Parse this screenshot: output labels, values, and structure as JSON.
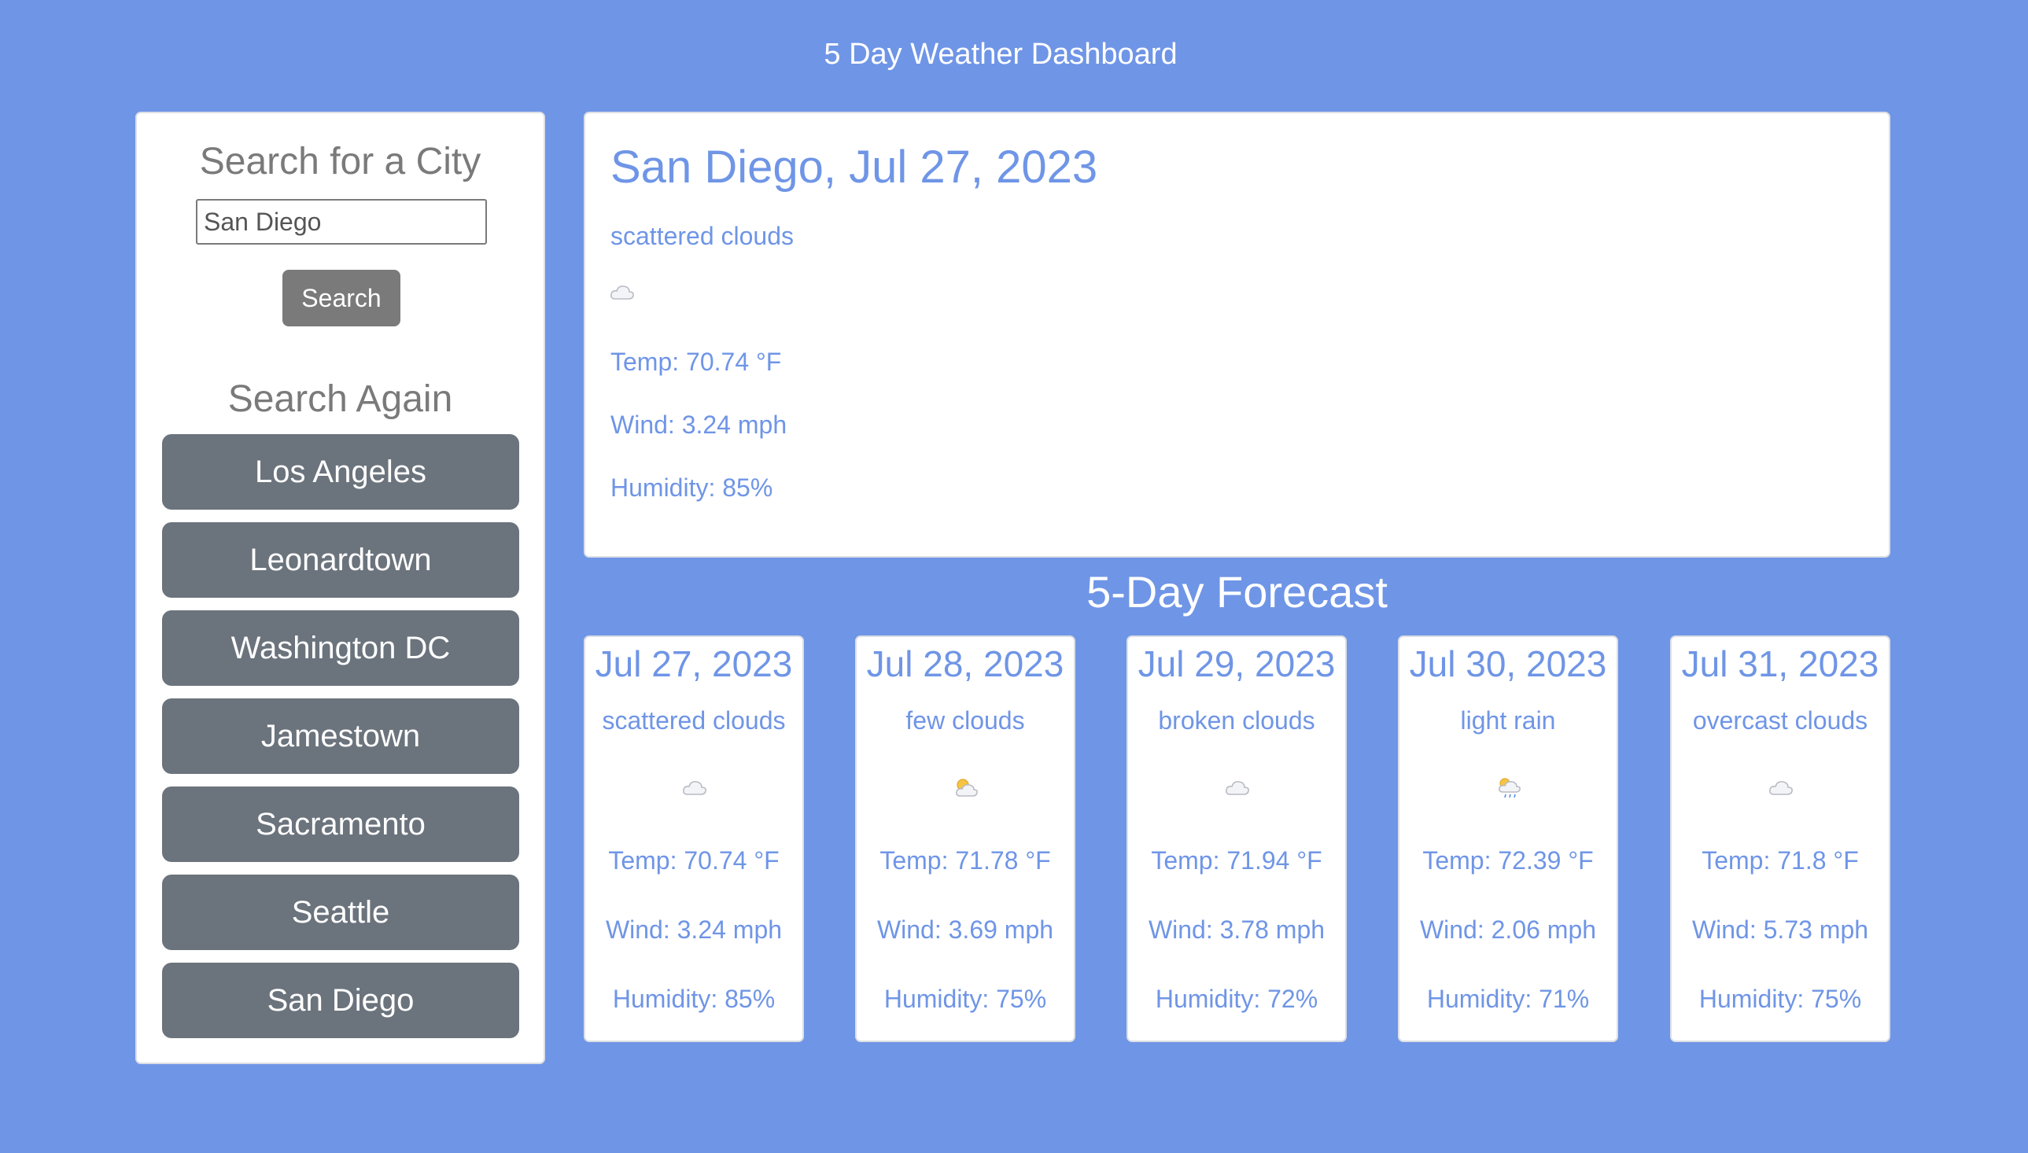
{
  "header": {
    "title": "5 Day Weather Dashboard"
  },
  "sidebar": {
    "search_heading": "Search for a City",
    "search_value": "San Diego",
    "search_button": "Search",
    "again_heading": "Search Again",
    "cities": [
      "Los Angeles",
      "Leonardtown",
      "Washington DC",
      "Jamestown",
      "Sacramento",
      "Seattle",
      "San Diego"
    ]
  },
  "current": {
    "title": "San Diego, Jul 27, 2023",
    "description": "scattered clouds",
    "icon": "scattered-clouds-icon",
    "temp": "Temp: 70.74 °F",
    "wind": "Wind: 3.24 mph",
    "humidity": "Humidity: 85%"
  },
  "forecast_heading": "5-Day Forecast",
  "forecast": [
    {
      "date": "Jul 27, 2023",
      "description": "scattered clouds",
      "icon": "scattered-clouds-icon",
      "temp": "Temp: 70.74 °F",
      "wind": "Wind: 3.24 mph",
      "humidity": "Humidity: 85%"
    },
    {
      "date": "Jul 28, 2023",
      "description": "few clouds",
      "icon": "few-clouds-icon",
      "temp": "Temp: 71.78 °F",
      "wind": "Wind: 3.69 mph",
      "humidity": "Humidity: 75%"
    },
    {
      "date": "Jul 29, 2023",
      "description": "broken clouds",
      "icon": "broken-clouds-icon",
      "temp": "Temp: 71.94 °F",
      "wind": "Wind: 3.78 mph",
      "humidity": "Humidity: 72%"
    },
    {
      "date": "Jul 30, 2023",
      "description": "light rain",
      "icon": "light-rain-icon",
      "temp": "Temp: 72.39 °F",
      "wind": "Wind: 2.06 mph",
      "humidity": "Humidity: 71%"
    },
    {
      "date": "Jul 31, 2023",
      "description": "overcast clouds",
      "icon": "overcast-clouds-icon",
      "temp": "Temp: 71.8 °F",
      "wind": "Wind: 5.73 mph",
      "humidity": "Humidity: 75%"
    }
  ],
  "colors": {
    "background": "#6f95e6",
    "accent_text": "#6f95e6",
    "city_button": "#6b737c",
    "search_button": "#7a7a7a"
  }
}
